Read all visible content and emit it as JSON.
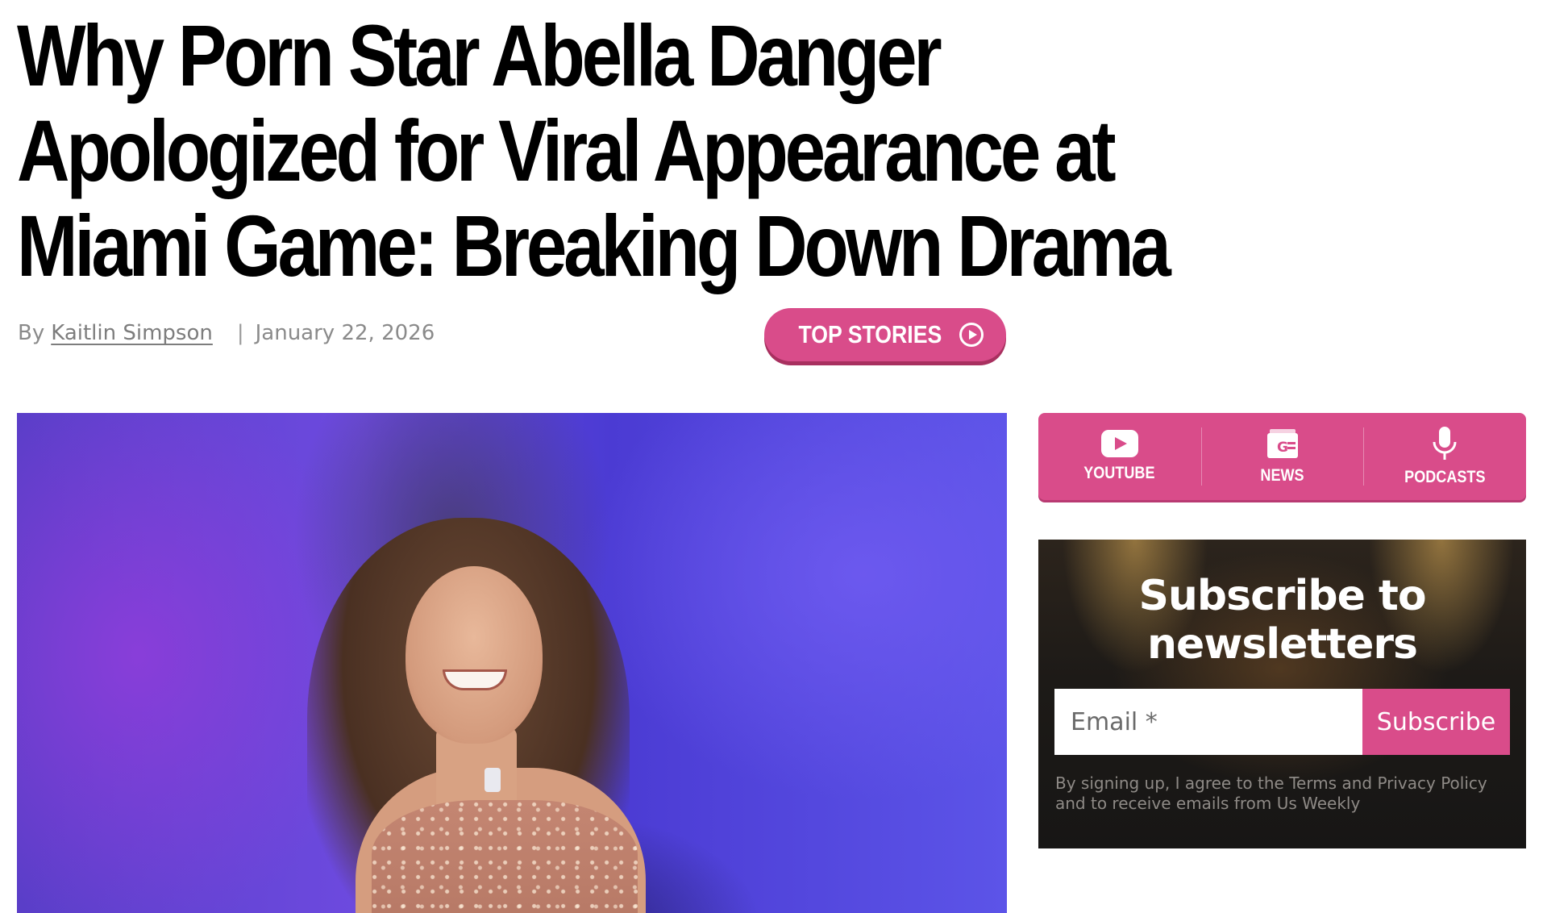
{
  "article": {
    "headline": "Why Porn Star Abella Danger Apologized for Viral Appearance at Miami Game: Breaking Down Drama",
    "byline_prefix": "By",
    "author": "Kaitlin Simpson",
    "separator": "|",
    "date": "January 22, 2026"
  },
  "top_stories": {
    "label": "TOP STORIES",
    "icon": "play-circle-icon"
  },
  "social": {
    "items": [
      {
        "label": "YOUTUBE",
        "icon": "youtube-icon"
      },
      {
        "label": "NEWS",
        "icon": "google-news-icon"
      },
      {
        "label": "PODCASTS",
        "icon": "microphone-icon"
      }
    ]
  },
  "newsletter": {
    "title": "Subscribe to newsletters",
    "email_placeholder": "Email *",
    "subscribe_label": "Subscribe",
    "disclaimer": "By signing up, I agree to the Terms and Privacy Policy and to receive emails from Us Weekly"
  },
  "colors": {
    "accent_pink": "#d94c8a",
    "newsletter_bg": "#1d1a17"
  }
}
